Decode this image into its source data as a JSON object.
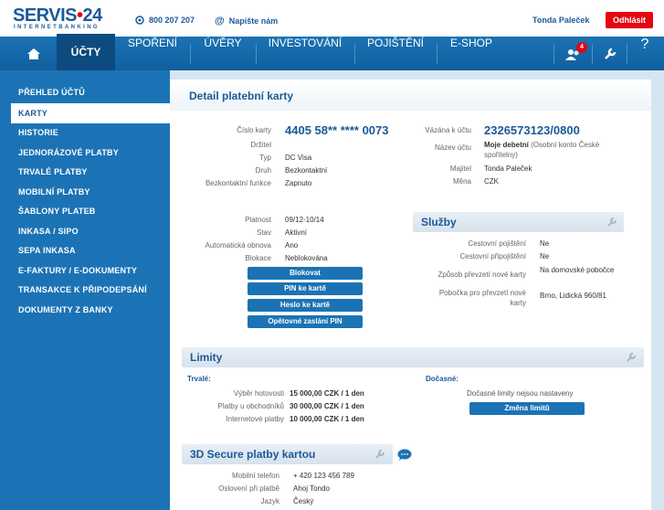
{
  "header": {
    "logo": "SERVIS",
    "logo_num": "24",
    "logo_sub": "INTERNETBANKING",
    "phone": "800 207 207",
    "write": "Napište nám",
    "user": "Tonda Paleček",
    "logout": "Odhlásit",
    "badge": "4"
  },
  "nav": {
    "tabs": [
      "ÚČTY",
      "SPOŘENÍ",
      "ÚVĚRY",
      "INVESTOVÁNÍ",
      "POJIŠTĚNÍ",
      "E-SHOP"
    ],
    "help": "?"
  },
  "sidebar": {
    "items": [
      "PŘEHLED ÚČTŮ",
      "KARTY",
      "HISTORIE",
      "JEDNORÁZOVÉ PLATBY",
      "TRVALÉ PLATBY",
      "MOBILNÍ PLATBY",
      "ŠABLONY PLATEB",
      "INKASA / SIPO",
      "SEPA INKASA",
      "E-FAKTURY / E-DOKUMENTY",
      "TRANSAKCE K PŘIPODEPSÁNÍ",
      "DOKUMENTY Z BANKY"
    ]
  },
  "page": {
    "title": "Detail platební karty"
  },
  "card": {
    "number_label": "Číslo karty",
    "number": "4405 58** **** 0073",
    "holder_label": "Držitel",
    "holder": "",
    "type_label": "Typ",
    "type": "DC Visa",
    "kind_label": "Druh",
    "kind": "Bezkontaktní",
    "contactless_label": "Bezkontaktní funkce",
    "contactless": "Zapnuto",
    "validity_label": "Platnost",
    "validity": "09/12-10/14",
    "state_label": "Stav",
    "state": "Aktivní",
    "renew_label": "Automatická obnova",
    "renew": "Ano",
    "block_label": "Blokace",
    "block": "Neblokována"
  },
  "account": {
    "linked_label": "Vázána k účtu",
    "linked": "2326573123/0800",
    "name_label": "Název účtu",
    "name_bold": "Moje debetní",
    "name_rest": " (Osobní konto České spořitelny)",
    "owner_label": "Majitel",
    "owner": "Tonda Paleček",
    "currency_label": "Měna",
    "currency": "CZK"
  },
  "buttons": {
    "block": "Blokovat",
    "pin": "PIN ke kartě",
    "password": "Heslo ke kartě",
    "resend_pin": "Opětovné zaslání PIN"
  },
  "services": {
    "title": "Služby",
    "travel_label": "Cestovní pojištění",
    "travel": "Ne",
    "accident_label": "Cestovní připojištění",
    "accident": "Ne",
    "pickup_label": "Způsob převzetí nové karty",
    "pickup": "Na domovské pobočce",
    "branch_label": "Pobočka pro převzetí nové karty",
    "branch": "Brno, Lidická 960/81"
  },
  "limits": {
    "title": "Limity",
    "permanent": "Trvalé:",
    "temporary": "Dočasné:",
    "rows": [
      {
        "label": "Výběr hotovosti",
        "value": "15 000,00 CZK / 1 den"
      },
      {
        "label": "Platby u obchodníků",
        "value": "30 000,00 CZK / 1 den"
      },
      {
        "label": "Internetové platby",
        "value": "10 000,00 CZK / 1 den"
      }
    ],
    "no_temp": "Dočasné limity nejsou nastaveny",
    "change": "Změna limitů"
  },
  "secure": {
    "title": "3D Secure platby kartou",
    "phone_label": "Mobilní telefon",
    "phone": "+ 420 123 456 789",
    "greeting_label": "Oslovení při platbě",
    "greeting": "Ahoj Tondo",
    "lang_label": "Jazyk",
    "lang": "Český"
  }
}
